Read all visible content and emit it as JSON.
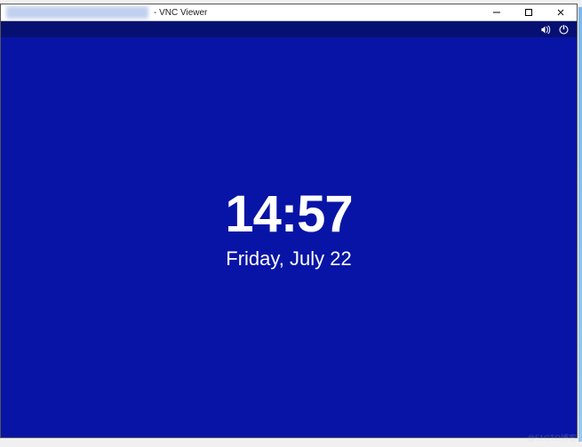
{
  "window": {
    "title_suffix": "- VNC Viewer"
  },
  "controls": {
    "minimize": "–",
    "maximize": "□",
    "close": "×"
  },
  "lockscreen": {
    "time": "14:57",
    "date": "Friday, July 22"
  },
  "colors": {
    "desktop_bg": "#0814a6",
    "strip_bg": "#061072"
  },
  "watermark": "@51CTO博客"
}
